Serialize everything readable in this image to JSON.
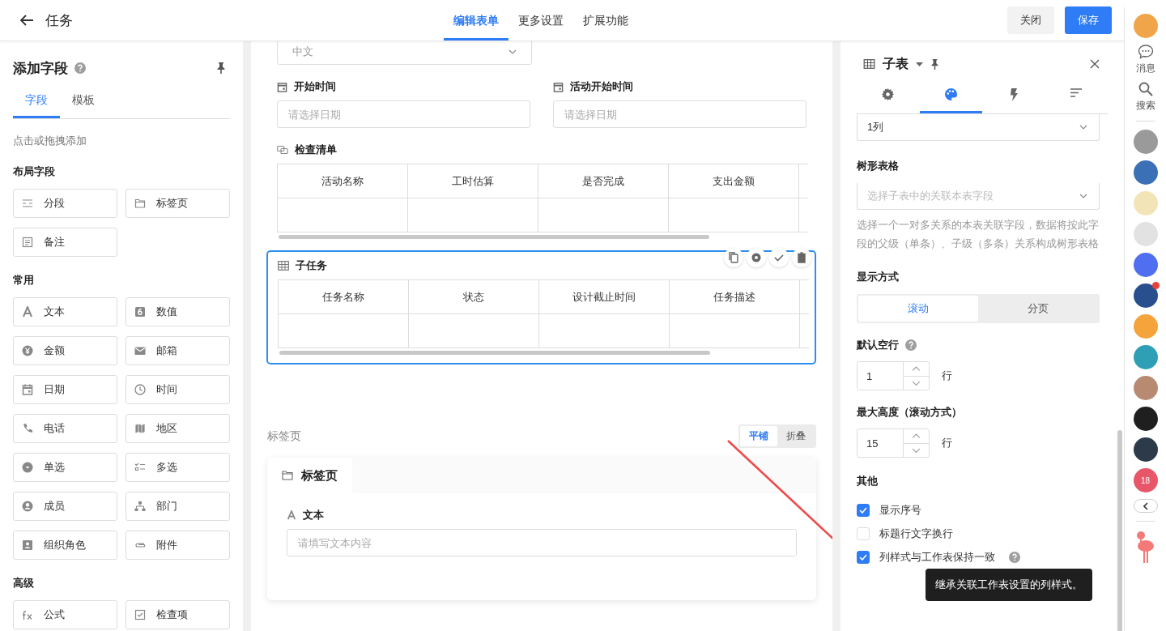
{
  "header": {
    "title": "任务",
    "tabs": [
      {
        "label": "编辑表单",
        "selected": true
      },
      {
        "label": "更多设置",
        "selected": false
      },
      {
        "label": "扩展功能",
        "selected": false
      }
    ],
    "buttons": [
      {
        "label": "关闭",
        "kind": "default"
      },
      {
        "label": "保存",
        "kind": "primary"
      }
    ]
  },
  "left_panel": {
    "title": "添加字段",
    "tabs": [
      {
        "label": "字段",
        "selected": true
      },
      {
        "label": "模板",
        "selected": false
      }
    ],
    "hint": "点击或拖拽添加",
    "groups": [
      {
        "title": "布局字段",
        "items": [
          {
            "label": "分段",
            "kind": "section"
          },
          {
            "label": "标签页",
            "kind": "folder"
          },
          {
            "label": "备注",
            "kind": "note"
          }
        ]
      },
      {
        "title": "常用",
        "items": [
          {
            "label": "文本",
            "kind": "text"
          },
          {
            "label": "数值",
            "kind": "number"
          },
          {
            "label": "金额",
            "kind": "money"
          },
          {
            "label": "邮箱",
            "kind": "mail"
          },
          {
            "label": "日期",
            "kind": "date"
          },
          {
            "label": "时间",
            "kind": "clock"
          },
          {
            "label": "电话",
            "kind": "phone"
          },
          {
            "label": "地区",
            "kind": "map"
          },
          {
            "label": "单选",
            "kind": "radio"
          },
          {
            "label": "多选",
            "kind": "multi"
          },
          {
            "label": "成员",
            "kind": "person"
          },
          {
            "label": "部门",
            "kind": "org"
          },
          {
            "label": "组织角色",
            "kind": "role"
          },
          {
            "label": "附件",
            "kind": "clip"
          }
        ]
      },
      {
        "title": "高级",
        "items": [
          {
            "label": "公式",
            "kind": "fx"
          },
          {
            "label": "检查项",
            "kind": "check"
          }
        ]
      }
    ]
  },
  "canvas": {
    "language_select": {
      "value": "中文"
    },
    "date_fields": [
      {
        "label": "开始时间",
        "placeholder": "请选择日期"
      },
      {
        "label": "活动开始时间",
        "placeholder": "请选择日期"
      }
    ],
    "subtables": [
      {
        "title": "检查清单",
        "kind": "link",
        "selected": false,
        "columns": [
          "活动名称",
          "工时估算",
          "是否完成",
          "支出金额"
        ]
      },
      {
        "title": "子任务",
        "kind": "grid",
        "selected": true,
        "columns": [
          "任务名称",
          "状态",
          "设计截止时间",
          "任务描述"
        ]
      }
    ],
    "tab_section": {
      "label": "标签页",
      "modes": [
        {
          "label": "平铺",
          "selected": true
        },
        {
          "label": "折叠",
          "selected": false
        }
      ],
      "tab": "标签页",
      "field": {
        "label": "文本",
        "placeholder": "请填写文本内容"
      }
    }
  },
  "right_panel": {
    "title": "子表",
    "tabs": [
      {
        "kind": "gear",
        "selected": false
      },
      {
        "kind": "palette",
        "selected": true
      },
      {
        "kind": "bolt",
        "selected": false
      },
      {
        "kind": "sort",
        "selected": false
      }
    ],
    "columns_select": {
      "value": "1列"
    },
    "tree_table": {
      "label": "树形表格",
      "placeholder": "选择子表中的关联本表字段",
      "help": "选择一个一对多关系的本表关联字段，数据将按此字段的父级（单条）、子级（多条）关系构成树形表格"
    },
    "display_mode": {
      "label": "显示方式",
      "options": [
        {
          "label": "滚动",
          "selected": true
        },
        {
          "label": "分页",
          "selected": false
        }
      ]
    },
    "numbers": [
      {
        "label": "默认空行",
        "help": true,
        "value": "1",
        "unit": "行"
      },
      {
        "label": "最大高度（滚动方式）",
        "help": false,
        "value": "15",
        "unit": "行"
      }
    ],
    "other": {
      "label": "其他",
      "options": [
        {
          "label": "显示序号",
          "checked": true,
          "help": false
        },
        {
          "label": "标题行文字换行",
          "checked": false,
          "help": false
        },
        {
          "label": "列样式与工作表保持一致",
          "checked": true,
          "help": true
        }
      ]
    },
    "tooltip": "继承关联工作表设置的列样式。"
  },
  "dock": {
    "actions": [
      {
        "label": "消息",
        "kind": "chat"
      },
      {
        "label": "搜索",
        "kind": "search"
      }
    ],
    "apps": [
      {
        "color": "#9a9a9a",
        "badge": false
      },
      {
        "color": "#3b6fb6",
        "badge": false
      },
      {
        "color": "#f3e4b8",
        "badge": false
      },
      {
        "color": "#e2e2e2",
        "badge": false
      },
      {
        "color": "#4f6ff0",
        "badge": false
      },
      {
        "color": "#2a4f8f",
        "badge": true
      },
      {
        "color": "#f5a33b",
        "badge": false
      },
      {
        "color": "#2f9fb6",
        "badge": false
      },
      {
        "color": "#b88a72",
        "badge": false
      },
      {
        "color": "#1f1f1f",
        "badge": false
      },
      {
        "color": "#2d3a4a",
        "badge": false
      }
    ],
    "calendar": "18"
  }
}
